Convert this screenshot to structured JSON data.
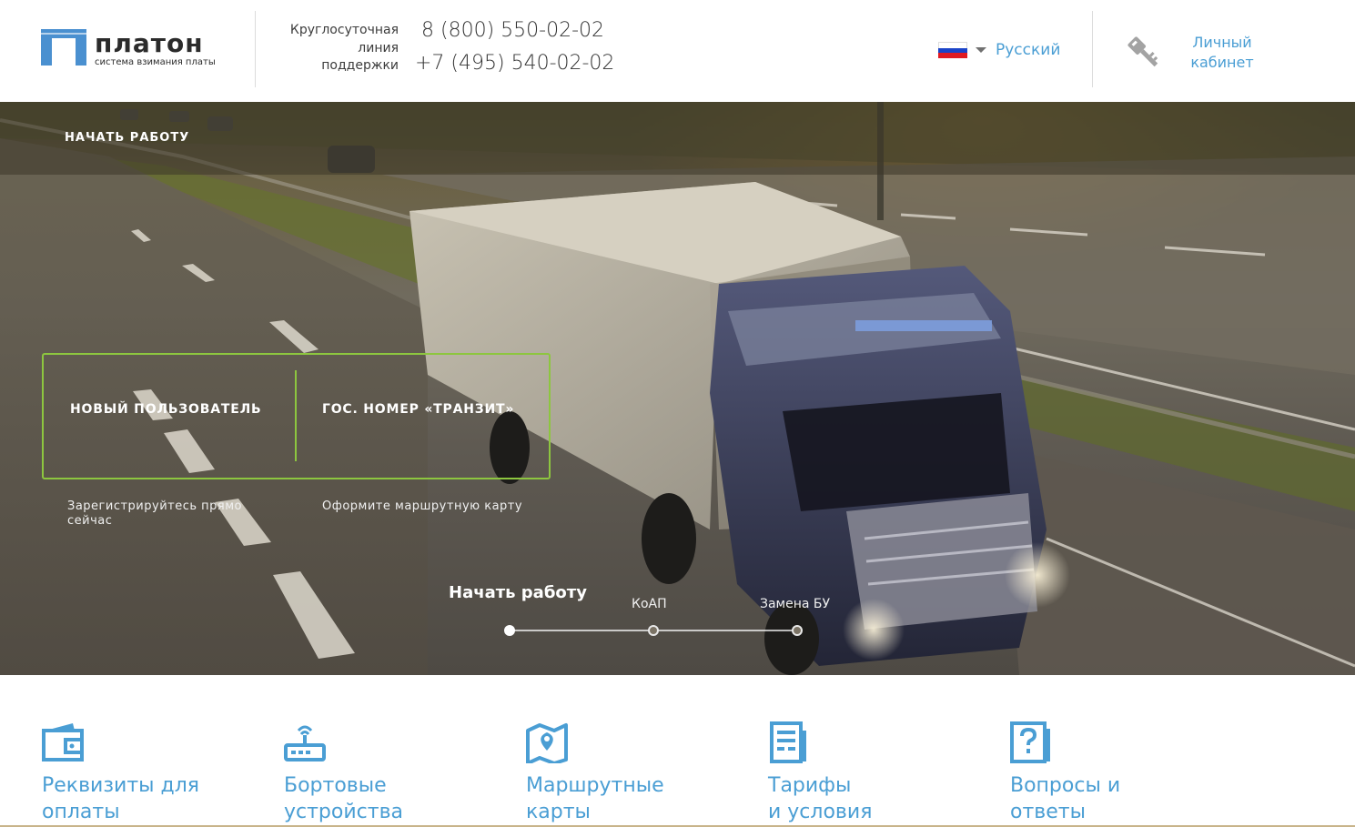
{
  "header": {
    "logo": {
      "name": "платон",
      "tagline": "система взимания платы"
    },
    "support": {
      "label_lines": [
        "Круглосуточная",
        "линия",
        "поддержки"
      ],
      "phone_1": "8 (800) 550-02-02",
      "phone_2": "+7 (495) 540-02-02"
    },
    "language": {
      "label": "Русский",
      "flag_colors": [
        "#ffffff",
        "#1b44c8",
        "#e01a22"
      ]
    },
    "cabinet": {
      "label_lines": [
        "Личный",
        "кабинет"
      ]
    }
  },
  "hero": {
    "topbar_link": "НАЧАТЬ РАБОТУ",
    "actions": [
      {
        "label": "НОВЫЙ ПОЛЬЗОВАТЕЛЬ",
        "description": "Зарегистрируйтесь прямо сейчас"
      },
      {
        "label": "ГОС. НОМЕР «ТРАНЗИТ»",
        "description": "Оформите маршрутную карту"
      }
    ],
    "slider": {
      "active": "Начать работу",
      "items": [
        "КоАП",
        "Замена БУ"
      ]
    }
  },
  "nav": [
    {
      "icon": "wallet-icon",
      "lines": [
        "Реквизиты для",
        "оплаты"
      ]
    },
    {
      "icon": "router-icon",
      "lines": [
        "Бортовые",
        "устройства"
      ]
    },
    {
      "icon": "map-pin-icon",
      "lines": [
        "Маршрутные",
        "карты"
      ]
    },
    {
      "icon": "document-icon",
      "lines": [
        "Тарифы",
        "и условия"
      ]
    },
    {
      "icon": "question-icon",
      "lines": [
        "Вопросы и",
        "ответы"
      ]
    }
  ],
  "colors": {
    "accent_blue": "#4a9ed4",
    "accent_green": "#8dc63f",
    "logo_blue": "#4a90d0"
  }
}
